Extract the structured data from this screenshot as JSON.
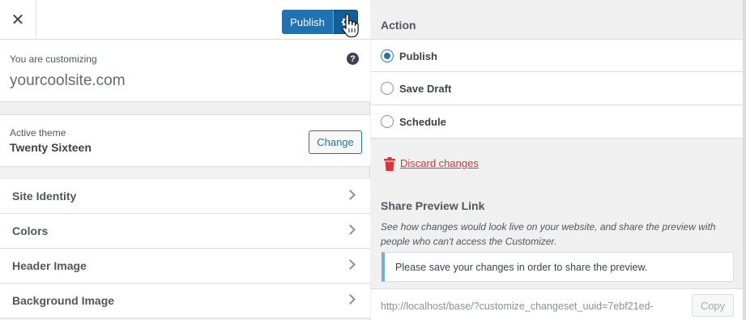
{
  "header": {
    "close_label": "✕",
    "publish_label": "Publish"
  },
  "info": {
    "customizing_label": "You are customizing",
    "site_name": "yourcoolsite.com",
    "help_label": "?"
  },
  "theme": {
    "label": "Active theme",
    "name": "Twenty Sixteen",
    "change_label": "Change"
  },
  "nav": {
    "items": [
      {
        "label": "Site Identity"
      },
      {
        "label": "Colors"
      },
      {
        "label": "Header Image"
      },
      {
        "label": "Background Image"
      }
    ]
  },
  "action": {
    "heading": "Action",
    "options": [
      {
        "label": "Publish",
        "checked": true
      },
      {
        "label": "Save Draft",
        "checked": false
      },
      {
        "label": "Schedule",
        "checked": false
      }
    ],
    "discard_label": "Discard changes"
  },
  "share": {
    "heading": "Share Preview Link",
    "description": "See how changes would look live on your website, and share the preview with people who can't access the Customizer.",
    "notice": "Please save your changes in order to share the preview.",
    "preview_url": "http://localhost/base/?customize_changeset_uuid=7ebf21ed-",
    "copy_label": "Copy"
  },
  "colors": {
    "primary": "#2271b1",
    "primary_dark": "#135e96",
    "danger": "#d63638",
    "notice_border": "#72aee6"
  }
}
